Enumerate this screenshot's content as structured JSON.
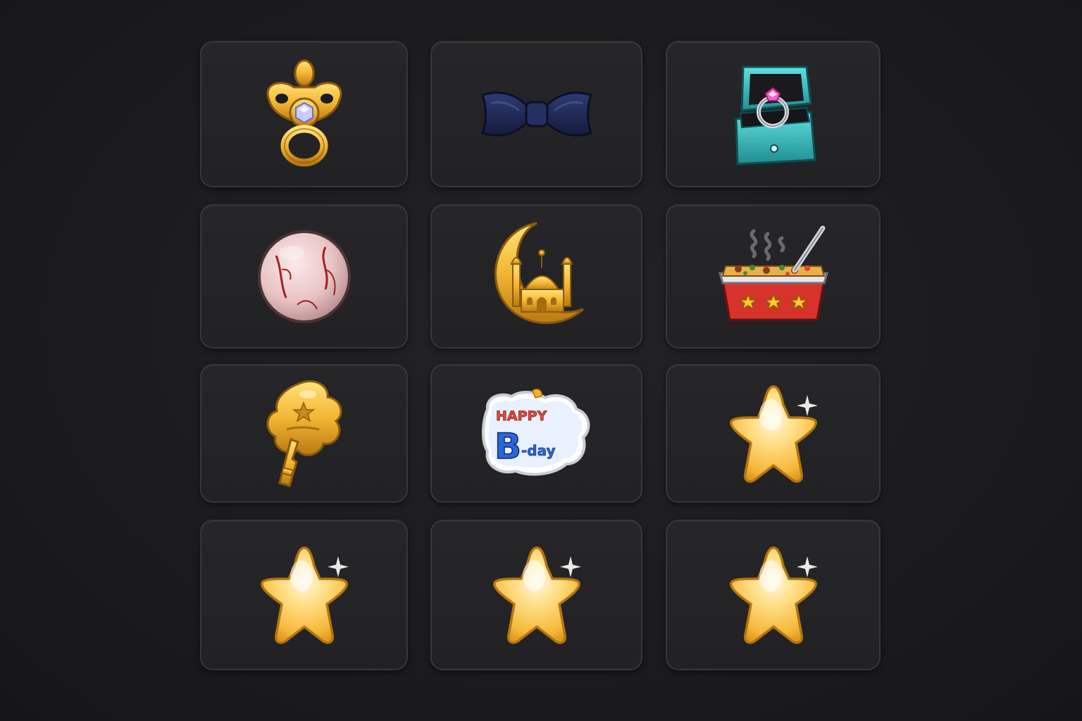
{
  "items": [
    {
      "id": "pacifier",
      "icon": "gold-pacifier-icon"
    },
    {
      "id": "bow-tie",
      "icon": "navy-bow-tie-icon"
    },
    {
      "id": "ring-box",
      "icon": "engagement-ring-box-icon"
    },
    {
      "id": "veined-orb",
      "icon": "veined-pink-orb-icon"
    },
    {
      "id": "crescent-mosque",
      "icon": "crescent-moon-mosque-icon"
    },
    {
      "id": "casserole",
      "icon": "steaming-casserole-icon"
    },
    {
      "id": "golden-key",
      "icon": "golden-flower-key-icon"
    },
    {
      "id": "birthday-sticker",
      "icon": "happy-birthday-sticker-icon",
      "text_line1": "HAPPY",
      "text_line2_big": "B",
      "text_line2_small": "-day"
    },
    {
      "id": "star-1",
      "icon": "sparkle-star-icon"
    },
    {
      "id": "star-2",
      "icon": "sparkle-star-icon"
    },
    {
      "id": "star-3",
      "icon": "sparkle-star-icon"
    },
    {
      "id": "star-4",
      "icon": "sparkle-star-icon"
    }
  ],
  "colors": {
    "background": "#1c1c1e",
    "tile": "#242426",
    "tile_border": "#37373a",
    "gold": "#f0b83a",
    "navy": "#1f2a55",
    "teal": "#2fb8b8",
    "casserole_red": "#d8322c"
  }
}
